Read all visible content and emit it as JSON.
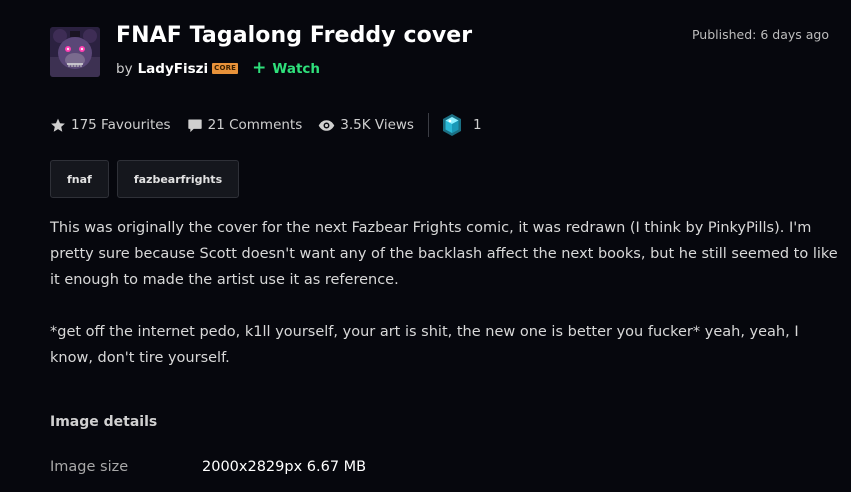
{
  "deviation": {
    "title": "FNAF Tagalong Freddy cover",
    "by_prefix": "by",
    "author": "LadyFiszi",
    "author_badge": "CORE",
    "watch_label": "Watch",
    "published": "Published: 6 days ago"
  },
  "stats": {
    "favourites": "175 Favourites",
    "comments": "21 Comments",
    "views": "3.5K Views",
    "awards": "1"
  },
  "tags": [
    "fnaf",
    "fazbearfrights"
  ],
  "description": {
    "paragraphs": [
      "This was originally the cover for the next Fazbear Frights comic, it was redrawn (I think by PinkyPills). I'm pretty sure because Scott doesn't want any of the backlash affect the next books, but he still seemed to like it enough to made the artist use it as reference.",
      "*get off the internet pedo, k1ll yourself, your art is shit, the new one is better you fucker* yeah, yeah, I know, don't tire yourself."
    ]
  },
  "image_details": {
    "heading": "Image details",
    "size_label": "Image size",
    "size_value": "2000x2829px 6.67 MB"
  },
  "colors": {
    "background": "#06070d",
    "watch_green": "#2fe07b",
    "core_badge": "#e8923a"
  }
}
